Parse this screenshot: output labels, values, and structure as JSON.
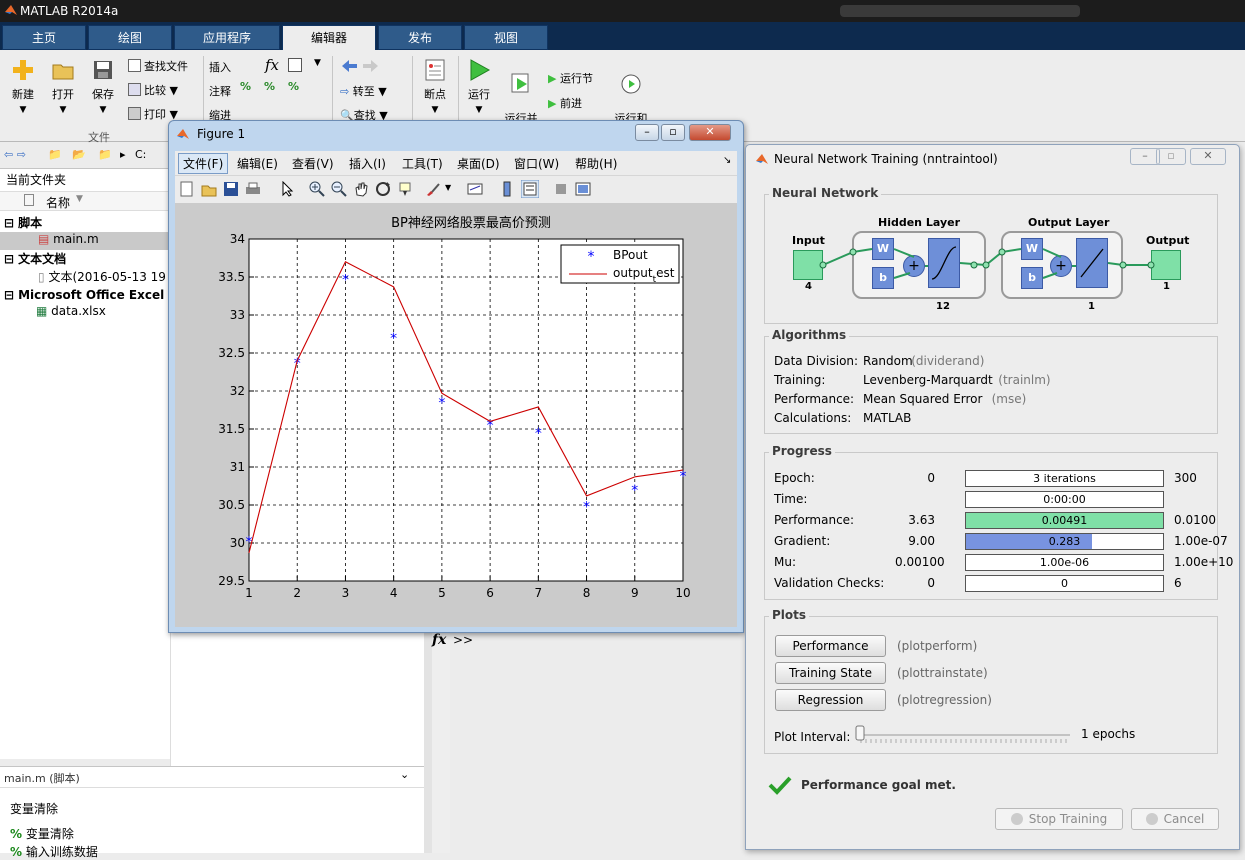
{
  "app": {
    "title": "MATLAB R2014a"
  },
  "tabs": [
    "主页",
    "绘图",
    "应用程序",
    "编辑器",
    "发布",
    "视图"
  ],
  "ribbon": {
    "file": [
      "新建",
      "打开",
      "保存"
    ],
    "file_small": [
      "查找文件",
      "比较",
      "打印"
    ],
    "file_group": "文件",
    "edit_small": [
      "插入",
      "注释",
      "缩进"
    ],
    "nav": [
      "转至",
      "查找"
    ],
    "breakpoint": "断点",
    "run": [
      "运行",
      "运行并\n前进",
      "运行节",
      "前进",
      "运行和\n计时"
    ]
  },
  "address": {
    "path": "C:"
  },
  "left": {
    "header": "当前文件夹",
    "col": "名称",
    "groups": [
      {
        "name": "脚本",
        "items": [
          "main.m"
        ]
      },
      {
        "name": "文本文档",
        "items": [
          "文本(2016-05-13 19"
        ]
      },
      {
        "name": "Microsoft Office Excel 工",
        "items": [
          "data.xlsx"
        ]
      }
    ]
  },
  "details": {
    "title": "main.m (脚本)",
    "head": "变量清除",
    "items": [
      "变量清除",
      "输入训练数据"
    ]
  },
  "command": {
    "fx": "fx",
    "prompt": ">>"
  },
  "figure": {
    "title": "Figure 1",
    "menu": [
      "文件(F)",
      "编辑(E)",
      "查看(V)",
      "插入(I)",
      "工具(T)",
      "桌面(D)",
      "窗口(W)",
      "帮助(H)"
    ]
  },
  "chart_data": {
    "type": "line",
    "title": "BP神经网络股票最高价预测",
    "xlabel": "",
    "ylabel": "",
    "x": [
      1,
      2,
      3,
      4,
      5,
      6,
      7,
      8,
      9,
      10
    ],
    "xticks": [
      "1",
      "2",
      "3",
      "4",
      "5",
      "6",
      "7",
      "8",
      "9",
      "10"
    ],
    "yticks": [
      "34",
      "33.5",
      "33",
      "32.5",
      "32",
      "31.5",
      "31",
      "30.5",
      "30",
      "29.5"
    ],
    "ylim": [
      29.5,
      34
    ],
    "grid": true,
    "legend_position": "top-right",
    "series": [
      {
        "name": "BPout",
        "style": "markers",
        "color": "#0000ff",
        "values": [
          30.02,
          32.37,
          33.47,
          32.7,
          31.85,
          31.55,
          31.45,
          30.48,
          30.7,
          30.88
        ]
      },
      {
        "name": "output_test",
        "legend_text": "output",
        "legend_sub": "t",
        "legend_rest": "est",
        "style": "line",
        "color": "#cc0000",
        "values": [
          29.87,
          32.4,
          33.7,
          33.37,
          31.97,
          31.6,
          31.79,
          30.62,
          30.87,
          30.96
        ]
      }
    ]
  },
  "nnt": {
    "title": "Neural Network Training (nntraintool)",
    "network": {
      "label": "Neural Network",
      "input": "Input",
      "input_n": "4",
      "hidden": "Hidden Layer",
      "hidden_n": "12",
      "output_layer": "Output Layer",
      "output_layer_n": "1",
      "output": "Output",
      "output_n": "1",
      "w": "W",
      "b": "b"
    },
    "algorithms": {
      "label": "Algorithms",
      "rows": [
        {
          "k": "Data Division:",
          "v": "Random",
          "f": "(dividerand)"
        },
        {
          "k": "Training:",
          "v": "Levenberg-Marquardt",
          "f": "(trainlm)"
        },
        {
          "k": "Performance:",
          "v": "Mean Squared Error",
          "f": "(mse)"
        },
        {
          "k": "Calculations:",
          "v": "MATLAB",
          "f": ""
        }
      ]
    },
    "progress": {
      "label": "Progress",
      "rows": [
        {
          "k": "Epoch:",
          "start": "0",
          "bar": "3 iterations",
          "fill": 0.01,
          "color": "#ffffff",
          "end": "300"
        },
        {
          "k": "Time:",
          "start": "",
          "bar": "0:00:00",
          "fill": 0,
          "color": "#ffffff",
          "end": ""
        },
        {
          "k": "Performance:",
          "start": "3.63",
          "bar": "0.00491",
          "fill": 1.0,
          "color": "#7fe0a7",
          "end": "0.0100"
        },
        {
          "k": "Gradient:",
          "start": "9.00",
          "bar": "0.283",
          "fill": 0.64,
          "color": "#7893e0",
          "end": "1.00e-07"
        },
        {
          "k": "Mu:",
          "start": "0.00100",
          "bar": "1.00e-06",
          "fill": 0,
          "color": "#ffffff",
          "end": "1.00e+10"
        },
        {
          "k": "Validation Checks:",
          "start": "0",
          "bar": "0",
          "fill": 0,
          "color": "#ffffff",
          "end": "6"
        }
      ]
    },
    "plots": {
      "label": "Plots",
      "rows": [
        {
          "btn": "Performance",
          "f": "(plotperform)"
        },
        {
          "btn": "Training State",
          "f": "(plottrainstate)"
        },
        {
          "btn": "Regression",
          "f": "(plotregression)"
        }
      ],
      "interval_label": "Plot Interval:",
      "interval_value": "1 epochs"
    },
    "status": "Performance goal met.",
    "stop": "Stop Training",
    "cancel": "Cancel"
  }
}
